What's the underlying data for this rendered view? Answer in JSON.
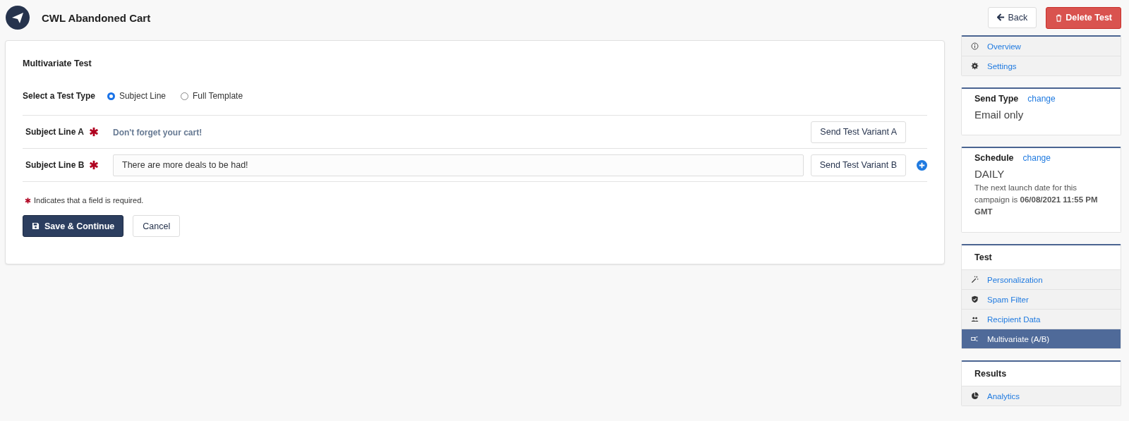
{
  "header": {
    "title": "CWL Abandoned Cart",
    "buttons": [
      {
        "label": "Back",
        "kind": "back"
      },
      {
        "label": "Delete Test",
        "kind": "delete"
      }
    ]
  },
  "form": {
    "title": "Multivariate Test",
    "test_type": {
      "label": "Select a Test Type",
      "options": [
        {
          "label": "Subject Line",
          "selected": true
        },
        {
          "label": "Full Template",
          "selected": false
        }
      ]
    },
    "subject_lines": [
      {
        "label": "Subject Line A",
        "kind": "text",
        "value": "Don't forget your cart!",
        "button": "Send Test Variant A",
        "add": false
      },
      {
        "label": "Subject Line B",
        "kind": "input",
        "value": "There are more deals to be had!",
        "button": "Send Test Variant B",
        "add": true
      }
    ],
    "required_note": "Indicates that a field is required.",
    "buttons": [
      {
        "label": "Save & Continue",
        "kind": "primary"
      },
      {
        "label": "Cancel",
        "kind": "secondary"
      }
    ]
  },
  "sidebar": {
    "nav": [
      {
        "label": "Overview",
        "kind": "info",
        "selected": false
      },
      {
        "label": "Settings",
        "kind": "gear",
        "selected": false
      }
    ],
    "send_type": {
      "title": "Send Type",
      "link": "change",
      "value": "Email only"
    },
    "schedule": {
      "title": "Schedule",
      "link": "change",
      "value": "DAILY",
      "note": "The next launch date for this campaign is **06/08/2021 11:55 PM GMT**"
    },
    "sections": [
      {
        "title": "Test",
        "items": [
          {
            "label": "Personalization",
            "kind": "wand",
            "selected": false
          },
          {
            "label": "Spam Filter",
            "kind": "shield",
            "selected": false
          },
          {
            "label": "Recipient Data",
            "kind": "people",
            "selected": false
          },
          {
            "label": "Multivariate (A/B)",
            "kind": "split",
            "selected": true
          }
        ]
      },
      {
        "title": "Results",
        "items": [
          {
            "label": "Analytics",
            "kind": "pie",
            "selected": false
          }
        ]
      }
    ]
  }
}
